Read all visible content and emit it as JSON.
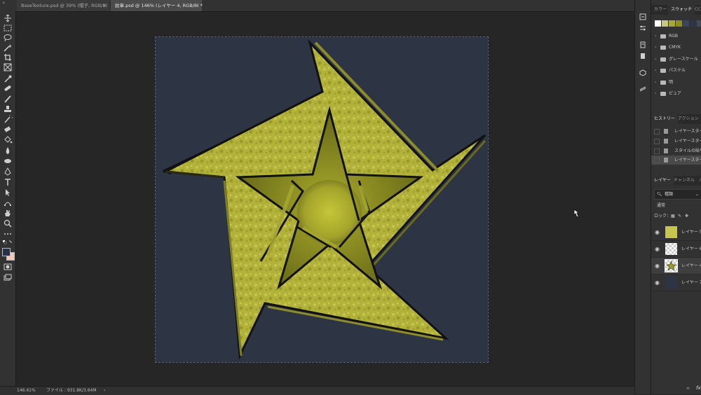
{
  "tabs": [
    {
      "label": "BaseTexture.psd @ 39% (帽子, RGB/8)",
      "close": "×"
    },
    {
      "label": "紋章.psd @ 146% (レイヤー 4, RGB/8) *",
      "close": "×"
    }
  ],
  "collapse_icon": "«",
  "status": {
    "zoom": "146.41%",
    "file_info": "ファイル : 931.8K/3.64M",
    "arrow": "›"
  },
  "tools": [
    "move-icon",
    "marquee-icon",
    "lasso-icon",
    "magic-wand-icon",
    "crop-icon",
    "frame-icon",
    "eyedropper-icon",
    "healing-icon",
    "brush-icon",
    "stamp-icon",
    "history-brush-icon",
    "eraser-icon",
    "paint-bucket-icon",
    "blur-icon",
    "dodge-icon",
    "pen-icon",
    "type-icon",
    "path-select-icon",
    "shape-icon",
    "hand-icon",
    "zoom-icon",
    "more-icon",
    "default-colors-icon",
    "quick-mask-icon",
    "screen-mode-icon"
  ],
  "colors": {
    "foreground": "#263046",
    "background": "#f2c8b8",
    "canvas": "#2d3444",
    "star": "#b5b52a"
  },
  "swatch_panel": {
    "tabs": [
      "カラー",
      "スウォッチ",
      "CC"
    ],
    "active_tab": "スウォッチ",
    "swatches": [
      "#ffffff",
      "#c8c87a",
      "#a7a73a",
      "#8c8c28",
      "#3b4458",
      "#2e3646",
      "#444a58"
    ],
    "groups": [
      "RGB",
      "CMYK",
      "グレースケール",
      "パステル",
      "明",
      "ピュア"
    ]
  },
  "history_panel": {
    "tabs": [
      "ヒストリー",
      "アクション"
    ],
    "items": [
      "レイヤースタイ",
      "レイヤースタイ",
      "スタイルの貼り",
      "レイヤースタイ"
    ]
  },
  "layers_panel": {
    "tabs": [
      "レイヤー",
      "チャンネル",
      "パ"
    ],
    "filter": "種類",
    "blend_mode": "通常",
    "lock_label": "ロック：",
    "layers": [
      {
        "name": "レイヤー 5",
        "visible": true,
        "thumb": "star-yellow"
      },
      {
        "name": "レイヤー 6",
        "visible": true,
        "thumb": "transparent"
      },
      {
        "name": "レイヤー 4",
        "visible": true,
        "thumb": "star-small",
        "selected": true
      },
      {
        "name": "レイヤー 7",
        "visible": true,
        "thumb": "navy"
      }
    ],
    "footer": [
      "link-icon",
      "fx"
    ]
  }
}
